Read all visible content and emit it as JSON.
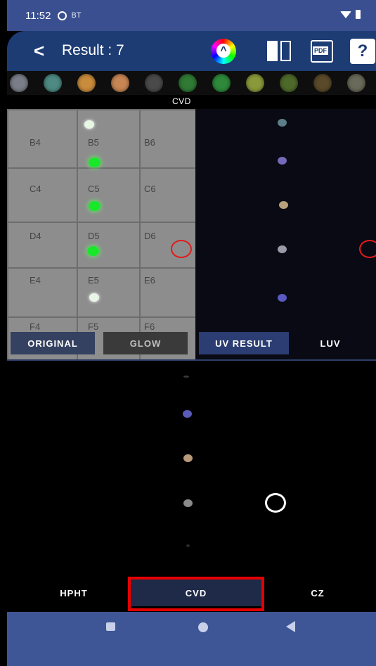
{
  "status_bar": {
    "time": "11:52",
    "bt_label": "BT"
  },
  "app_bar": {
    "title": "Result : 7"
  },
  "swatches": [
    "#7a7e88",
    "#4e8a83",
    "#c98c3c",
    "#c88654",
    "#4a4a4a",
    "#2f7a34",
    "#2e8a3a",
    "#8a9a3a",
    "#4e6a2a",
    "#5a4a2a",
    "#6a6a5a"
  ],
  "section_label": "CVD",
  "grid_cells": [
    "B4",
    "B5",
    "B6",
    "C4",
    "C5",
    "C6",
    "D4",
    "D5",
    "D6",
    "E4",
    "E5",
    "E6",
    "F4",
    "F5",
    "F6"
  ],
  "panel_tabs": [
    "ORIGINAL",
    "GLOW",
    "UV RESULT",
    "LUV"
  ],
  "bottom_tabs": [
    "HPHT",
    "CVD",
    "CZ"
  ],
  "selected_bottom_tab": "CVD",
  "colors": {
    "accent": "#1d3c74",
    "status": "#3a4f8f",
    "highlight": "#e50000"
  }
}
